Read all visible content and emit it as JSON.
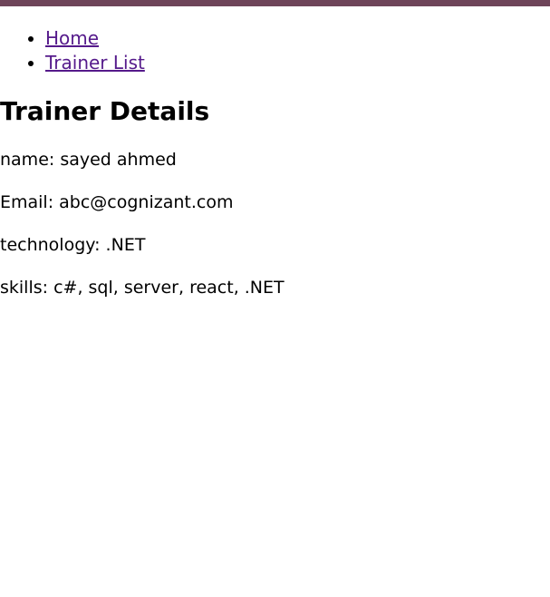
{
  "nav": {
    "items": [
      {
        "label": "Home"
      },
      {
        "label": "Trainer List"
      }
    ]
  },
  "page_title": "Trainer Details",
  "details": {
    "name": "name: sayed ahmed",
    "email": "Email: abc@cognizant.com",
    "technology": "technology: .NET",
    "skills": "skills: c#, sql, server, react, .NET"
  },
  "colors": {
    "top_bar": "#6e4459",
    "link": "#551a8b"
  }
}
